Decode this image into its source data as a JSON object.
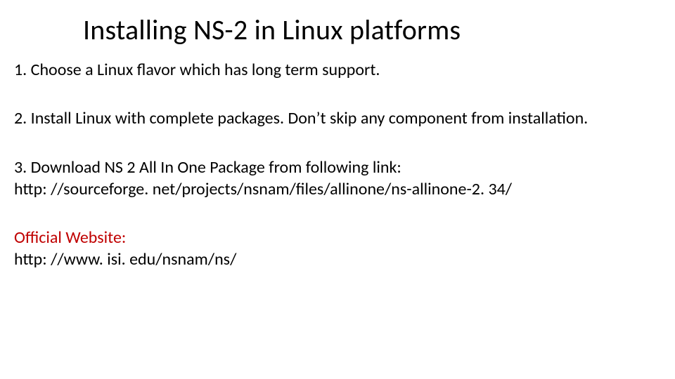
{
  "title": "Installing NS-2 in Linux platforms",
  "steps": {
    "s1": "1. Choose a Linux flavor which has long term support.",
    "s2": "2. Install Linux with complete packages. Don’t skip any component from installation.",
    "s3": "3. Download NS 2 All In One Package from following link:",
    "s3link": "http: //sourceforge. net/projects/nsnam/files/allinone/ns-allinone-2. 34/"
  },
  "official": {
    "label": "Official Website:",
    "url": "http: //www. isi. edu/nsnam/ns/"
  }
}
